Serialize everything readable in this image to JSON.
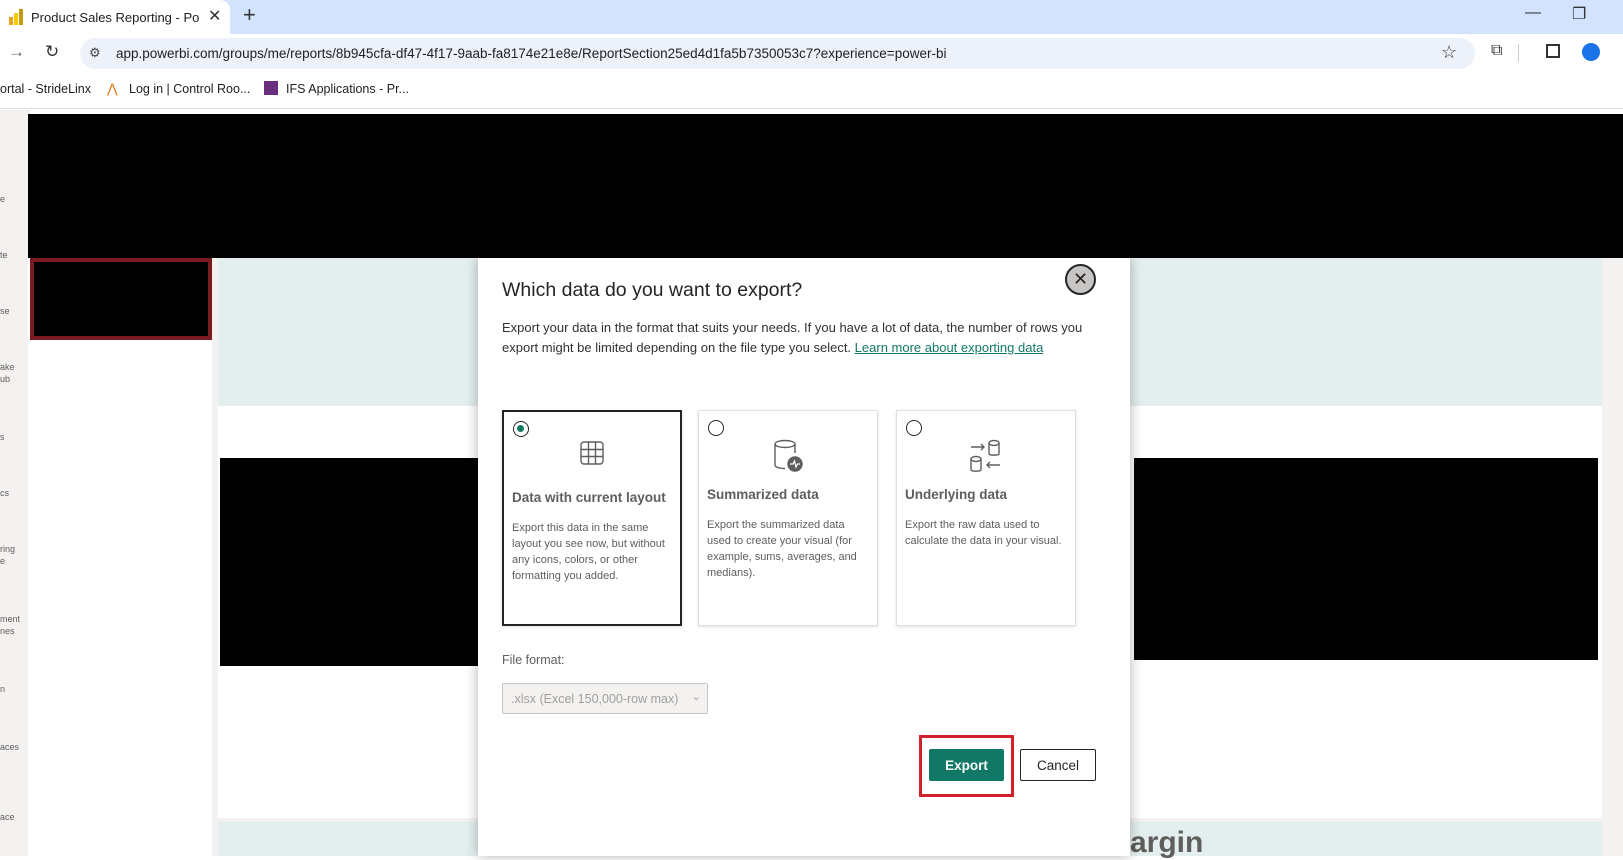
{
  "browser": {
    "tab_title": "Product Sales Reporting - Powe",
    "url": "app.powerbi.com/groups/me/reports/8b945cfa-df47-4f17-9aab-fa8174e21e8e/ReportSection25ed4d1fa5b7350053c7?experience=power-bi",
    "bookmarks": [
      "ortal - StrideLinx",
      "Log in | Control Roo...",
      "IFS Applications - Pr..."
    ]
  },
  "left_rail": {
    "labels": [
      "e",
      "te",
      "se",
      "ake",
      "ub",
      "s",
      "cs",
      "ring",
      "e",
      "ment",
      "nes",
      "n",
      "aces",
      "ace"
    ]
  },
  "dialog": {
    "title": "Which data do you want to export?",
    "description": "Export your data in the format that suits your needs. If you have a lot of data, the number of rows you export might be limited depending on the file type you select.",
    "learn_more": "Learn more about exporting data",
    "options": [
      {
        "title": "Data with current layout",
        "description": "Export this data in the same layout you see now, but without any icons, colors, or other formatting you added.",
        "selected": true,
        "icon": "table-icon"
      },
      {
        "title": "Summarized data",
        "description": "Export the summarized data used to create your visual (for example, sums, averages, and medians).",
        "selected": false,
        "icon": "database-activity-icon"
      },
      {
        "title": "Underlying data",
        "description": "Export the raw data used to calculate the data in your visual.",
        "selected": false,
        "icon": "data-transfer-icon"
      }
    ],
    "file_format_label": "File format:",
    "file_format_value": ".xlsx (Excel 150,000-row max)",
    "export_label": "Export",
    "cancel_label": "Cancel"
  },
  "background": {
    "partial_text": "argin"
  },
  "colors": {
    "accent": "#117865",
    "highlight": "#d4202c"
  }
}
